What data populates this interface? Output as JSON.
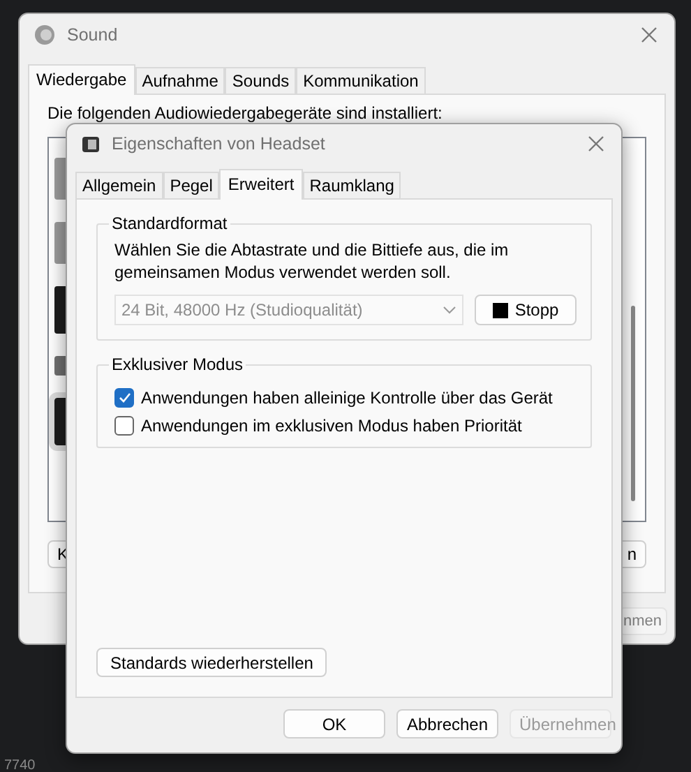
{
  "sound_window": {
    "title": "Sound",
    "tabs": [
      {
        "label": "Wiedergabe",
        "selected": true
      },
      {
        "label": "Aufnahme",
        "selected": false
      },
      {
        "label": "Sounds",
        "selected": false
      },
      {
        "label": "Kommunikation",
        "selected": false
      }
    ],
    "intro": "Die folgenden Audiowiedergabegeräte sind installiert:",
    "buttons": [
      "K",
      "n"
    ],
    "apply_button": "nmen"
  },
  "dialog": {
    "title": "Eigenschaften von Headset",
    "tabs": [
      {
        "label": "Allgemein",
        "selected": false
      },
      {
        "label": "Pegel",
        "selected": false
      },
      {
        "label": "Erweitert",
        "selected": true
      },
      {
        "label": "Raumklang",
        "selected": false
      }
    ],
    "standard_format": {
      "heading": "Standardformat",
      "description": "Wählen Sie die Abtastrate und die Bittiefe aus, die im gemeinsamen Modus verwendet werden soll.",
      "format": {
        "value": "24 Bit, 48000 Hz (Studioqualität)",
        "disabled": true
      },
      "test_button": "Stopp"
    },
    "exclusive_mode": {
      "heading": "Exklusiver Modus",
      "options": [
        {
          "label": "Anwendungen haben alleinige Kontrolle über das Gerät",
          "checked": true
        },
        {
          "label": "Anwendungen im exklusiven Modus haben Priorität",
          "checked": false
        }
      ]
    },
    "restore_button": "Standards wiederherstellen",
    "buttons": [
      {
        "label": "OK",
        "disabled": false
      },
      {
        "label": "Abbrechen",
        "disabled": false
      },
      {
        "label": "Übernehmen",
        "disabled": true
      }
    ]
  },
  "desktop_text": "7740"
}
